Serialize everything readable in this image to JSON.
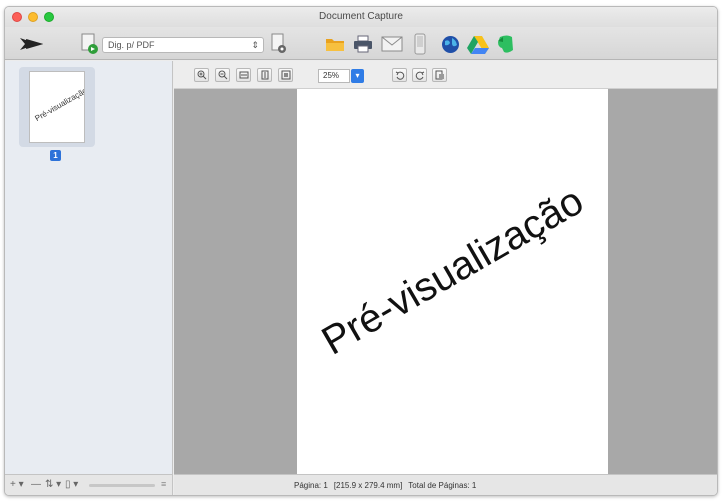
{
  "window": {
    "title": "Document Capture"
  },
  "toolbar": {
    "job_select_value": "Dig. p/ PDF",
    "icons": [
      "scan-icon",
      "job-icon",
      "job-settings-icon",
      "open-folder-icon",
      "print-icon",
      "email-icon",
      "device-icon",
      "web-icon",
      "google-drive-icon",
      "evernote-icon"
    ]
  },
  "sidebar": {
    "thumbnail_text": "Pré-visualização",
    "page_number": "1"
  },
  "viewer": {
    "zoom": "25%",
    "preview_text": "Pré-visualização"
  },
  "statusbar": {
    "page": "Página: 1",
    "size": "[215.9 x 279.4 mm]",
    "total": "Total de Páginas: 1"
  }
}
